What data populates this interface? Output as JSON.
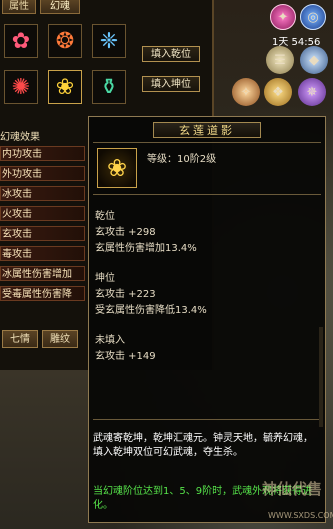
{
  "tabs": [
    "属性",
    "幻魂"
  ],
  "slots_icons": [
    "red-spirit-icon",
    "fire-spirit-icon",
    "blue-dragon-icon",
    "red-beast-icon",
    "golden-lotus-icon",
    "jade-vessel-icon"
  ],
  "buttons": {
    "fill_qian": "填入乾位",
    "fill_kun": "填入坤位"
  },
  "effects": {
    "title": "幻魂效果",
    "rows": [
      "内功攻击",
      "外功攻击",
      "冰攻击",
      "火攻击",
      "玄攻击",
      "毒攻击",
      "冰属性伤害增加",
      "受毒属性伤害降"
    ]
  },
  "bottom_tabs": [
    "七情",
    "雕纹"
  ],
  "hud": {
    "time": "1天 54:56"
  },
  "tooltip": {
    "title": "玄莲道影",
    "level": "等级：10阶2级",
    "qian_title": "乾位",
    "qian_lines": [
      "玄攻击 +298",
      "玄属性伤害增加13.4%"
    ],
    "kun_title": "坤位",
    "kun_lines": [
      "玄攻击 +223",
      "受玄属性伤害降低13.4%"
    ],
    "unfilled_title": "未填入",
    "unfilled_lines": [
      "玄攻击 +149"
    ],
    "description": "武魂寄乾坤，乾坤汇魂元。钟灵天地，毓养幻魂，填入乾坤双位可幻武魂，夺生杀。",
    "green_note": "当幻魂阶位达到1、5、9阶时，武魂外观将获得进化。"
  },
  "watermark": {
    "brand": "神仙代售",
    "url": "WWW.SXDS.COM"
  }
}
